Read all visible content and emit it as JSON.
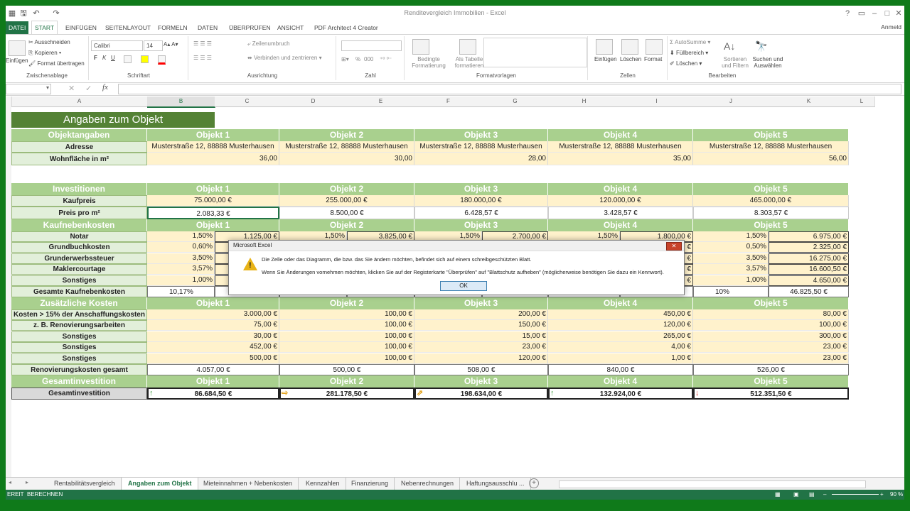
{
  "window": {
    "title": "Renditevergleich Immobilien - Excel",
    "user": "Anmeld"
  },
  "tabs": [
    "DATEI",
    "START",
    "EINFÜGEN",
    "SEITENLAYOUT",
    "FORMELN",
    "DATEN",
    "ÜBERPRÜFEN",
    "ANSICHT",
    "PDF Architect 4 Creator"
  ],
  "ribbon": {
    "clipboard": {
      "paste": "Einfügen",
      "cut": "Ausschneiden",
      "copy": "Kopieren",
      "format_painter": "Format übertragen",
      "label": "Zwischenablage"
    },
    "font": {
      "name": "Calibri",
      "size": "14",
      "bold": "F",
      "italic": "K",
      "underline": "U",
      "label": "Schriftart"
    },
    "alignment": {
      "wrap": "Zeilenumbruch",
      "merge": "Verbinden und zentrieren",
      "label": "Ausrichtung"
    },
    "number": {
      "percent": "%",
      "thousands": "000",
      "label": "Zahl"
    },
    "styles": {
      "conditional": "Bedingte Formatierung",
      "as_table": "Als Tabelle formatieren",
      "label": "Formatvorlagen"
    },
    "cells": {
      "insert": "Einfügen",
      "delete": "Löschen",
      "format": "Format",
      "label": "Zellen"
    },
    "editing": {
      "autosum": "AutoSumme",
      "fill": "Füllbereich",
      "clear": "Löschen",
      "sort": "Sortieren und Filtern",
      "find": "Suchen und Auswählen",
      "label": "Bearbeiten"
    }
  },
  "formula_bar": {
    "fx": "fx"
  },
  "columns": [
    "A",
    "B",
    "C",
    "D",
    "E",
    "F",
    "G",
    "H",
    "I",
    "J",
    "K",
    "L"
  ],
  "sheet": {
    "title": "Angaben zum Objekt",
    "obj_headers": [
      "Objekt 1",
      "Objekt 2",
      "Objekt 3",
      "Objekt 4",
      "Objekt 5"
    ],
    "sec1": {
      "label": "Objektangaben",
      "address_label": "Adresse",
      "addresses": [
        "Musterstraße 12, 88888 Musterhausen",
        "Musterstraße 12, 88888 Musterhausen",
        "Musterstraße 12, 88888 Musterhausen",
        "Musterstraße 12, 88888 Musterhausen",
        "Musterstraße 12, 88888 Musterhausen"
      ],
      "area_label": "Wohnfläche in m²",
      "areas": [
        "36,00",
        "30,00",
        "28,00",
        "35,00",
        "56,00"
      ]
    },
    "sec2": {
      "label": "Investitionen",
      "price_label": "Kaufpreis",
      "prices": [
        "75.000,00 €",
        "255.000,00 €",
        "180.000,00 €",
        "120.000,00 €",
        "465.000,00 €"
      ],
      "ppm_label": "Preis pro m²",
      "ppm": [
        "2.083,33 €",
        "8.500,00 €",
        "6.428,57 €",
        "3.428,57 €",
        "8.303,57 €"
      ]
    },
    "sec3": {
      "label": "Kaufnebenkosten",
      "rows": [
        {
          "label": "Notar",
          "v": [
            [
              "1,50%",
              "1.125,00 €"
            ],
            [
              "1,50%",
              "3.825,00 €"
            ],
            [
              "1,50%",
              "2.700,00 €"
            ],
            [
              "1,50%",
              "1.800,00 €"
            ],
            [
              "1,50%",
              "6.975,00 €"
            ]
          ]
        },
        {
          "label": "Grundbuchkosten",
          "v": [
            [
              "0,60%",
              ""
            ],
            [
              "",
              ""
            ],
            [
              "",
              ""
            ],
            [
              "",
              "€"
            ],
            [
              "0,50%",
              "2.325,00 €"
            ]
          ]
        },
        {
          "label": "Grunderwerbssteuer",
          "v": [
            [
              "3,50%",
              ""
            ],
            [
              "",
              ""
            ],
            [
              "",
              ""
            ],
            [
              "",
              "€"
            ],
            [
              "3,50%",
              "16.275,00 €"
            ]
          ]
        },
        {
          "label": "Maklercourtage",
          "v": [
            [
              "3,57%",
              ""
            ],
            [
              "",
              ""
            ],
            [
              "",
              ""
            ],
            [
              "",
              "€"
            ],
            [
              "3,57%",
              "16.600,50 €"
            ]
          ]
        },
        {
          "label": "Sonstiges",
          "v": [
            [
              "1,00%",
              ""
            ],
            [
              "",
              ""
            ],
            [
              "",
              ""
            ],
            [
              "",
              "€"
            ],
            [
              "1,00%",
              "4.650,00 €"
            ]
          ]
        }
      ],
      "total_label": "Gesamte Kaufnebenkosten",
      "totals": [
        [
          "10,17%",
          ""
        ],
        [
          "",
          ""
        ],
        [
          "",
          ""
        ],
        [
          "",
          ""
        ],
        [
          "10%",
          "46.825,50 €"
        ]
      ]
    },
    "sec4": {
      "label": "Zusätzliche Kosten",
      "rows": [
        {
          "label": "Kosten > 15% der Anschaffungskosten",
          "v": [
            "3.000,00 €",
            "100,00 €",
            "200,00 €",
            "450,00 €",
            "80,00 €"
          ]
        },
        {
          "label": "z. B. Renovierungsarbeiten",
          "v": [
            "75,00 €",
            "100,00 €",
            "150,00 €",
            "120,00 €",
            "100,00 €"
          ]
        },
        {
          "label": "Sonstiges",
          "v": [
            "30,00 €",
            "100,00 €",
            "15,00 €",
            "265,00 €",
            "300,00 €"
          ]
        },
        {
          "label": "Sonstiges",
          "v": [
            "452,00 €",
            "100,00 €",
            "23,00 €",
            "4,00 €",
            "23,00 €"
          ]
        },
        {
          "label": "Sonstiges",
          "v": [
            "500,00 €",
            "100,00 €",
            "120,00 €",
            "1,00 €",
            "23,00 €"
          ]
        }
      ],
      "total_label": "Renovierungskosten gesamt",
      "totals": [
        "4.057,00 €",
        "500,00 €",
        "508,00 €",
        "840,00 €",
        "526,00 €"
      ]
    },
    "sec5": {
      "label": "Gesamtinvestition",
      "row_label": "Gesamtinvestition",
      "values": [
        "86.684,50 €",
        "281.178,50 €",
        "198.634,00 €",
        "132.924,00 €",
        "512.351,50 €"
      ],
      "arrows": [
        "↑",
        "⇨",
        "⇗",
        "↑",
        "↓"
      ],
      "arrow_colors": [
        "#3a9a3a",
        "#e3a21a",
        "#e3a21a",
        "#3a9a3a",
        "#d8322c"
      ]
    }
  },
  "dialog": {
    "title": "Microsoft Excel",
    "line1": "Die Zelle oder das Diagramm, die bzw. das Sie ändern möchten, befindet sich auf einem schreibgeschützten Blatt.",
    "line2": "Wenn Sie Änderungen vornehmen möchten, klicken Sie auf der Registerkarte \"Überprüfen\" auf \"Blattschutz aufheben\" (möglicherweise benötigen Sie dazu ein Kennwort).",
    "ok": "OK"
  },
  "sheet_tabs": [
    "Rentabilitätsvergleich",
    "Angaben zum Objekt",
    "Mieteinnahmen + Nebenkosten",
    "Kennzahlen",
    "Finanzierung",
    "Nebenrechnungen",
    "Haftungsausschlu ..."
  ],
  "status": {
    "ready": "EREIT",
    "calc": "BERECHNEN",
    "zoom": "90 %"
  }
}
